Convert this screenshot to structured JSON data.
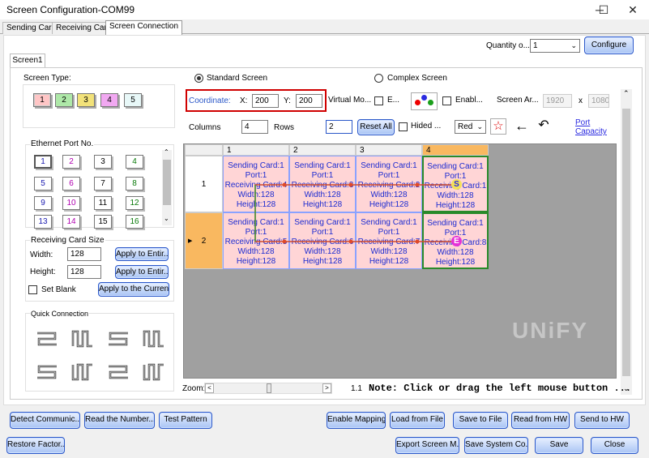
{
  "window": {
    "title": "Screen Configuration-COM99",
    "minimize": "─",
    "maximize": "☐",
    "close": "✕"
  },
  "tabs": [
    "Sending Card",
    "Receiving Card",
    "Screen Connection"
  ],
  "top": {
    "quantity_label": "Quantity o...",
    "quantity_value": "1",
    "configure": "Configure"
  },
  "screen_tab": "Screen1",
  "screen_type": {
    "label": "Screen Type:",
    "options": [
      "1",
      "2",
      "3",
      "4",
      "5"
    ]
  },
  "mode": {
    "standard": "Standard Screen",
    "complex": "Complex Screen"
  },
  "coordinate": {
    "label": "Coordinate:",
    "x_label": "X:",
    "x": "200",
    "y_label": "Y:",
    "y": "200"
  },
  "virtual": {
    "label": "Virtual Mo...",
    "e_label": "E...",
    "enable_label": "Enabl...",
    "screen_area_label": "Screen Ar...",
    "width": "1920",
    "x_sep": "x",
    "height": "1080"
  },
  "layout": {
    "columns_label": "Columns",
    "columns": "4",
    "rows_label": "Rows",
    "rows": "2",
    "reset_all": "Reset All",
    "hidden_label": "Hided ...",
    "color": "Red",
    "port_capacity": "Port\nCapacity"
  },
  "ethernet": {
    "label": "Ethernet Port No.",
    "ports": [
      "1",
      "2",
      "3",
      "4",
      "5",
      "6",
      "7",
      "8",
      "9",
      "10",
      "11",
      "12",
      "13",
      "14",
      "15",
      "16"
    ]
  },
  "rc_size": {
    "label": "Receiving Card Size",
    "width_label": "Width:",
    "width": "128",
    "height_label": "Height:",
    "height": "128",
    "apply_entire": "Apply to Entir...",
    "set_blank": "Set Blank",
    "apply_current": "Apply to the Curren..."
  },
  "quick": {
    "label": "Quick Connection"
  },
  "grid": {
    "col_headers": [
      "1",
      "2",
      "3",
      "4"
    ],
    "row_headers": [
      "1",
      "2"
    ],
    "cells": [
      [
        {
          "l1": "Sending Card:1",
          "l2": "Port:1",
          "l3": "Receiving Card:4",
          "l4": "Width:128",
          "l5": "Height:128"
        },
        {
          "l1": "Sending Card:1",
          "l2": "Port:1",
          "l3": "Receiving Card:3",
          "l4": "Width:128",
          "l5": "Height:128"
        },
        {
          "l1": "Sending Card:1",
          "l2": "Port:1",
          "l3": "Receiving Card:2",
          "l4": "Width:128",
          "l5": "Height:128"
        },
        {
          "l1": "Sending Card:1",
          "l2": "Port:1",
          "l3": "Receiving Card:1",
          "l4": "Width:128",
          "l5": "Height:128"
        }
      ],
      [
        {
          "l1": "Sending Card:1",
          "l2": "Port:1",
          "l3": "Receiving Card:5",
          "l4": "Width:128",
          "l5": "Height:128"
        },
        {
          "l1": "Sending Card:1",
          "l2": "Port:1",
          "l3": "Receiving Card:6",
          "l4": "Width:128",
          "l5": "Height:128"
        },
        {
          "l1": "Sending Card:1",
          "l2": "Port:1",
          "l3": "Receiving Card:7",
          "l4": "Width:128",
          "l5": "Height:128"
        },
        {
          "l1": "Sending Card:1",
          "l2": "Port:1",
          "l3": "Receiving Card:8",
          "l4": "Width:128",
          "l5": "Height:128"
        }
      ]
    ],
    "start_marker": "S",
    "end_marker": "E",
    "watermark": "UNiFY"
  },
  "zoom": {
    "label": "Zoom:",
    "value": "1.1",
    "note": "Note: Click or drag the left mouse button ..."
  },
  "footer_row1": [
    "Detect Communic...",
    "Read the Number...",
    "Test Pattern",
    "Enable Mapping",
    "Load from File",
    "Save to File",
    "Read from HW",
    "Send to HW"
  ],
  "footer_row2": [
    "Restore Factor...",
    "Export Screen M...",
    "Save System Co...",
    "Save",
    "Close"
  ],
  "colors": {
    "accent": "#2a57c8",
    "cell_bg": "#ffd5d6",
    "cell_text": "#1d2bd1",
    "highlight": "#d00000",
    "selected_col": "#f9b860"
  }
}
